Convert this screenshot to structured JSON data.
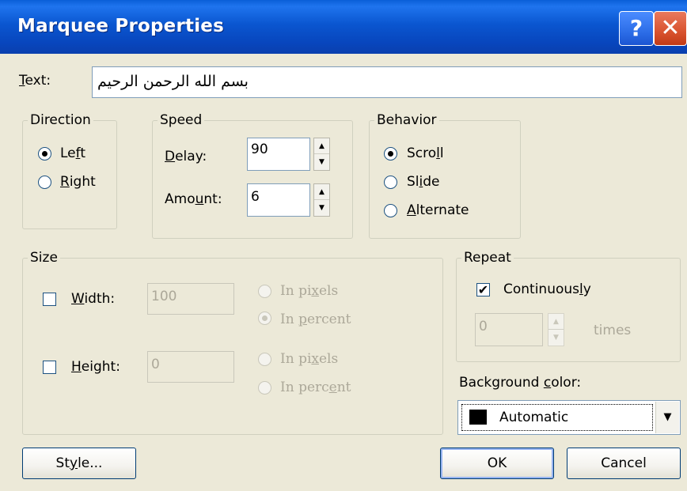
{
  "dialog": {
    "title": "Marquee Properties",
    "help_label": "?",
    "close_label": "✕"
  },
  "text_field": {
    "label_key": "T",
    "label_rest": "ext:",
    "value": "بسم الله الرحمن الرحيم"
  },
  "direction": {
    "legend": "Direction",
    "left": {
      "pre": "Le",
      "key": "f",
      "post": "t",
      "checked": true
    },
    "right": {
      "pre": "",
      "key": "R",
      "post": "ight",
      "checked": false
    }
  },
  "speed": {
    "legend": "Speed",
    "delay": {
      "pre": "",
      "key": "D",
      "post": "elay:",
      "value": "90"
    },
    "amount": {
      "pre": "Amo",
      "key": "u",
      "post": "nt:",
      "value": "6"
    }
  },
  "behavior": {
    "legend": "Behavior",
    "scroll": {
      "pre": "Scro",
      "key": "l",
      "post": "l",
      "checked": true
    },
    "slide": {
      "pre": "Sl",
      "key": "i",
      "post": "de",
      "checked": false
    },
    "alternate": {
      "pre": "",
      "key": "A",
      "post": "lternate",
      "checked": false
    }
  },
  "size": {
    "legend": "Size",
    "width": {
      "pre": "",
      "key": "W",
      "post": "idth:",
      "value": "100",
      "checked": false
    },
    "height": {
      "pre": "",
      "key": "H",
      "post": "eight:",
      "value": "0",
      "checked": false
    },
    "w_pixels": {
      "pre": "In pi",
      "key": "x",
      "post": "els"
    },
    "w_percent": {
      "pre": "In ",
      "key": "p",
      "post": "ercent"
    },
    "h_pixels": {
      "pre": "In pi",
      "key": "x",
      "post": "els"
    },
    "h_percent": {
      "pre": "In perc",
      "key": "e",
      "post": "nt"
    }
  },
  "repeat": {
    "legend": "Repeat",
    "continuously": {
      "pre": "Continuous",
      "key": "l",
      "post": "y",
      "checked": true
    },
    "times_value": "0",
    "times_label": "times"
  },
  "background": {
    "label_pre": "Background ",
    "label_key": "c",
    "label_post": "olor:",
    "selected": "Automatic",
    "swatch_color": "#000000"
  },
  "buttons": {
    "style": {
      "pre": "St",
      "key": "y",
      "post": "le..."
    },
    "ok": "OK",
    "cancel": "Cancel"
  },
  "colors": {
    "title_bar": "#0a56d0",
    "dialog_bg": "#ece9d8",
    "radio_dot": "#21a121"
  }
}
